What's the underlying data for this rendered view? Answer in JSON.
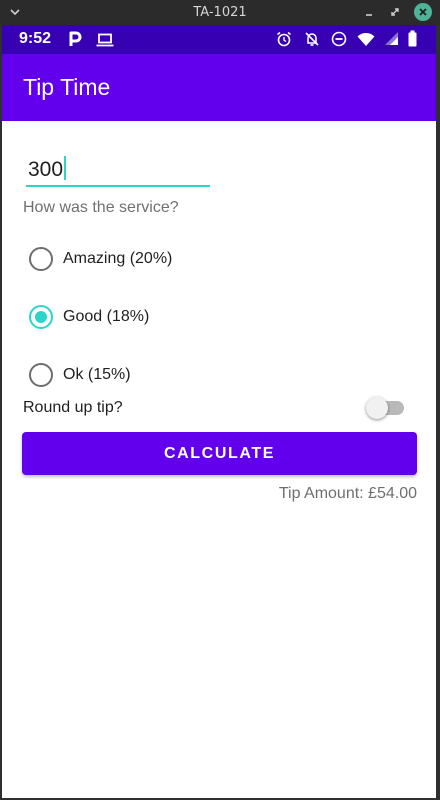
{
  "window": {
    "title": "TA-1021",
    "collapse_icon": "chevron-down-icon",
    "minimize_icon": "minimize-icon",
    "maximize_icon": "maximize-icon",
    "close_icon": "close-icon"
  },
  "status_bar": {
    "time": "9:52",
    "icons": [
      "parking-icon",
      "laptop-icon",
      "alarm-icon",
      "notifications-off-icon",
      "do-not-disturb-icon",
      "wifi-icon",
      "signal-icon",
      "battery-icon"
    ]
  },
  "app_bar": {
    "title": "Tip Time"
  },
  "form": {
    "cost_value": "300",
    "service_question": "How was the service?",
    "options": [
      {
        "label": "Amazing (20%)",
        "checked": false
      },
      {
        "label": "Good (18%)",
        "checked": true
      },
      {
        "label": "Ok (15%)",
        "checked": false
      }
    ],
    "round_up_label": "Round up tip?",
    "round_up_on": false,
    "calculate_label": "CALCULATE",
    "tip_amount": "Tip Amount: £54.00"
  },
  "colors": {
    "primary": "#6200ee",
    "primary_dark": "#3700b3",
    "accent": "#2bd6c9"
  }
}
